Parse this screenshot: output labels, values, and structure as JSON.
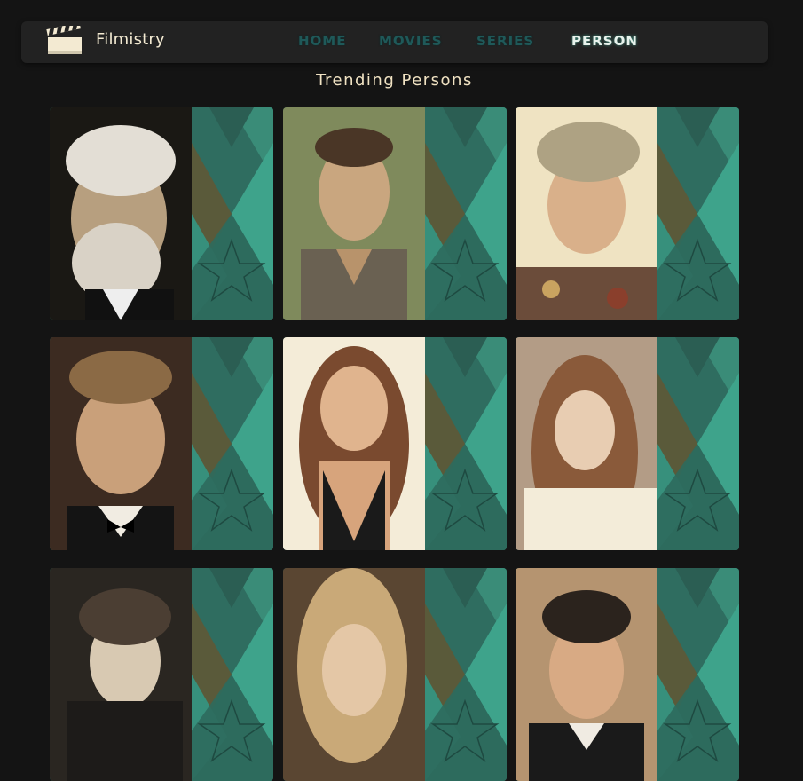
{
  "header": {
    "brand": "Filmistry",
    "nav": [
      {
        "label": "HOME",
        "active": false
      },
      {
        "label": "MOVIES",
        "active": false
      },
      {
        "label": "SERIES",
        "active": false
      },
      {
        "label": "PERSON",
        "active": true
      }
    ]
  },
  "main": {
    "title": "Trending Persons"
  },
  "colors": {
    "background": "#141414",
    "navbar": "#222222",
    "nav_inactive": "#1f5959",
    "nav_active": "#e8f2ec",
    "title": "#f1e3c3",
    "card_teal": "#2a5c52",
    "card_accent": "#3ea38b"
  }
}
